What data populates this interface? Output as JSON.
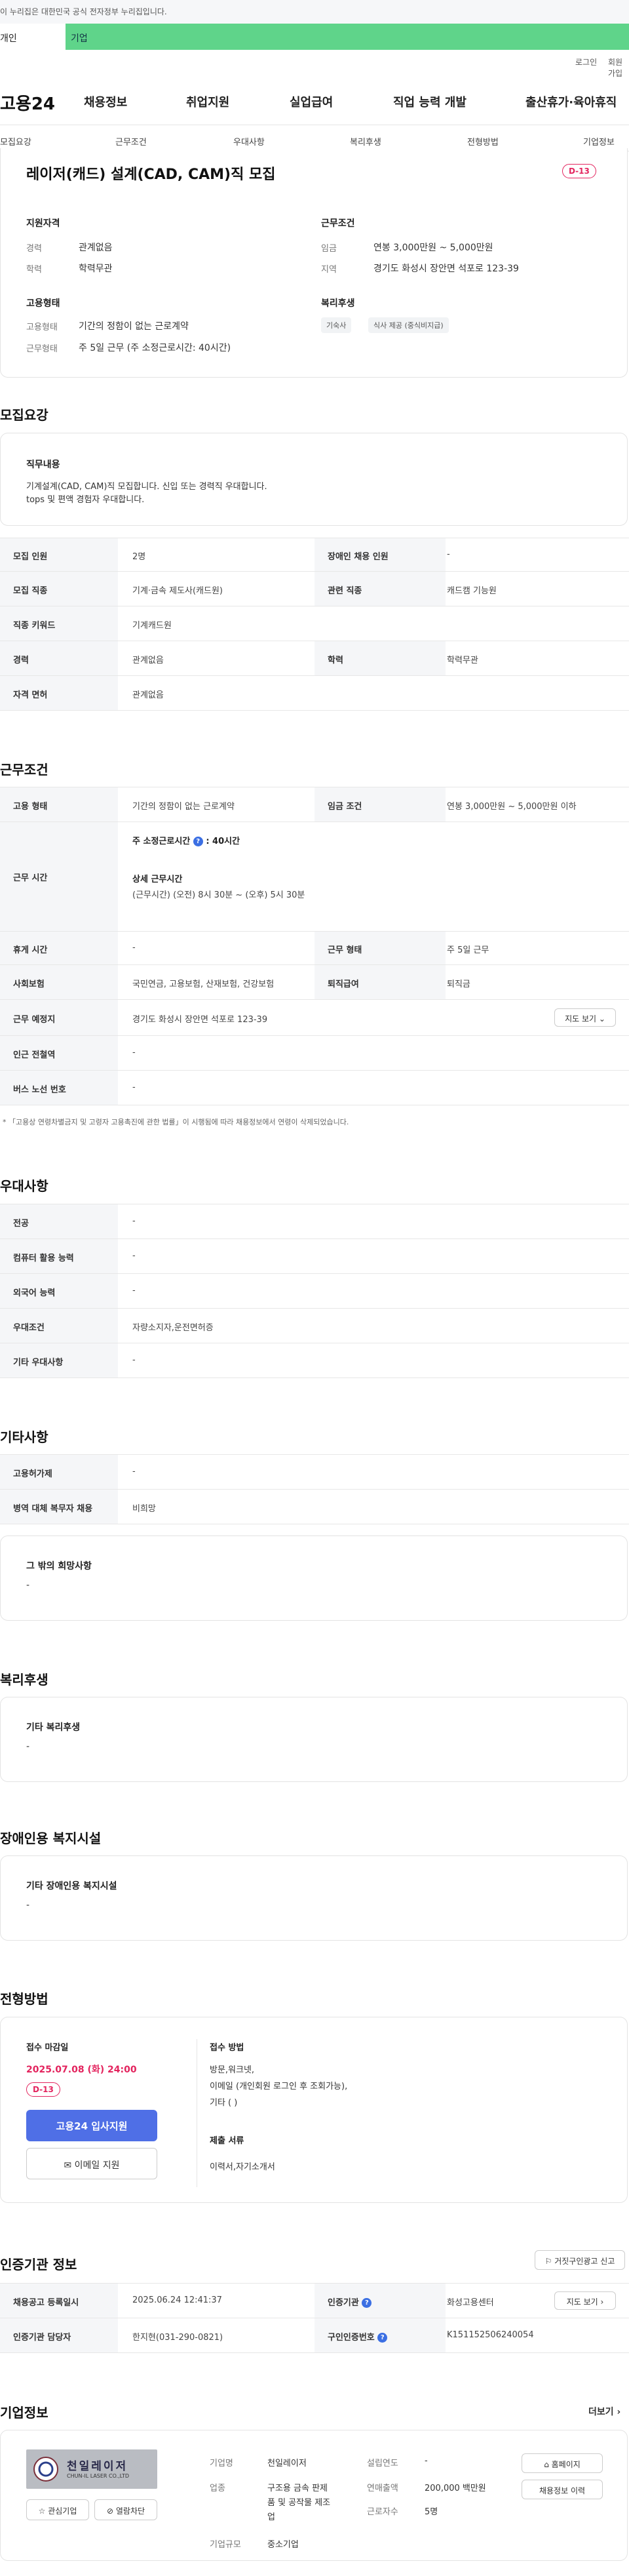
{
  "gov_banner": "이 누리집은 대한민국 공식 전자정부 누리집입니다.",
  "tabs": [
    "개인",
    "기업"
  ],
  "util": [
    "로그인",
    "회원가입"
  ],
  "logo": "고용24",
  "gnb": [
    "채용정보",
    "취업지원",
    "실업급여",
    "직업 능력 개발",
    "출산휴가·육아휴직"
  ],
  "anchors": [
    "모집요강",
    "근무조건",
    "우대사항",
    "복리후생",
    "전형방법",
    "기업정보"
  ],
  "job": {
    "title": "레이저(캐드) 설계(CAD, CAM)직 모집",
    "dday": "D-13",
    "qual_title": "지원자격",
    "career_label": "경력",
    "career": "관계없음",
    "edu_label": "학력",
    "edu": "학력무관",
    "emp_title": "고용형태",
    "emp_label": "고용형태",
    "emp": "기간의 정함이 없는 근로계약",
    "work_label": "근무형태",
    "work": "주 5일 근무 (주 소정근로시간: 40시간)",
    "cond_title": "근무조건",
    "wage_label": "임금",
    "wage": "연봉 3,000만원 ~ 5,000만원",
    "area_label": "지역",
    "area": "경기도 화성시 장안면 석포로 123-39",
    "welfare_title": "복리후생",
    "chips": [
      "기숙사",
      "식사 제공 (중식비지급)"
    ]
  },
  "recruit": {
    "title": "모집요강",
    "duty_title": "직무내용",
    "duty_lines": [
      "기계설계(CAD, CAM)직 모집합니다. 신입 또는 경력직 우대합니다.",
      "tops 및 편액 경험자 우대합니다."
    ],
    "rows": [
      {
        "l1": "모집 인원",
        "v1": "2명",
        "l2": "장애인 채용 인원",
        "v2": "-"
      },
      {
        "l1": "모집 직종",
        "v1": "기계·금속 제도사(캐드원)",
        "l2": "관련 직종",
        "v2": "캐드캠 기능원"
      },
      {
        "l1": "직종 키워드",
        "v1": "기계캐드원"
      },
      {
        "l1": "경력",
        "v1": "관계없음",
        "l2": "학력",
        "v2": "학력무관"
      },
      {
        "l1": "자격 면허",
        "v1": "관계없음"
      }
    ]
  },
  "work_cond": {
    "title": "근무조건",
    "emp_label": "고용 형태",
    "emp": "기간의 정함이 없는 근로계약",
    "wage_label": "임금 조건",
    "wage": "연봉 3,000만원 ~ 5,000만원 이하",
    "time_label": "근무 시간",
    "weekly_label": "주 소정근로시간",
    "weekly": ": 40시간",
    "detail_label": "상세 근무시간",
    "detail": "(근무시간) (오전) 8시 30분 ~ (오후) 5시 30분",
    "rows": [
      {
        "l1": "휴게 시간",
        "v1": "-",
        "l2": "근무 형태",
        "v2": "주 5일 근무"
      },
      {
        "l1": "사회보험",
        "v1": "국민연금, 고용보험, 산재보험, 건강보험",
        "l2": "퇴직급여",
        "v2": "퇴직금"
      }
    ],
    "place_label": "근무 예정지",
    "place": "경기도 화성시 장안면 석포로 123-39",
    "map_btn": "지도 보기",
    "subway_label": "인근 전철역",
    "subway": "-",
    "bus_label": "버스 노선 번호",
    "bus": "-",
    "note": "* 「고용상 연령차별금지 및 고령자 고용촉진에 관한 법률」이 시행됨에 따라 채용정보에서 연령이 삭제되었습니다."
  },
  "pref": {
    "title": "우대사항",
    "rows": [
      {
        "l": "전공",
        "v": "-"
      },
      {
        "l": "컴퓨터 활용 능력",
        "v": "-"
      },
      {
        "l": "외국어 능력",
        "v": "-"
      },
      {
        "l": "우대조건",
        "v": "자량소지자,운전면허증"
      },
      {
        "l": "기타 우대사항",
        "v": "-"
      }
    ]
  },
  "etc": {
    "title": "기타사항",
    "rows": [
      {
        "l": "고용허가제",
        "v": "-"
      },
      {
        "l": "병역 대체 복무자 채용",
        "v": "비희망"
      }
    ],
    "box_title": "그 밖의 희망사항",
    "box_val": "-"
  },
  "welfare": {
    "title": "복리후생",
    "box_title": "기타 복리후생",
    "box_val": "-"
  },
  "disab": {
    "title": "장애인용 복지시설",
    "box_title": "기타 장애인용 복지시설",
    "box_val": "-"
  },
  "process": {
    "title": "전형방법",
    "deadline_label": "접수 마감일",
    "deadline": "2025.07.08 (화) 24:00",
    "dday": "D-13",
    "apply_btn": "고용24 입사지원",
    "email_btn": "이메일 지원",
    "method_label": "접수 방법",
    "method_lines": [
      "방문,워크넷,",
      "이메일 (개인회원 로그인 후 조회가능),",
      "기타 ( )"
    ],
    "docs_label": "제출 서류",
    "docs": "이력서,자기소개서"
  },
  "cert": {
    "title": "인증기관 정보",
    "report_btn": "거짓구인광고 신고",
    "reg_label": "채용공고 등록일시",
    "reg": "2025.06.24 12:41:37",
    "org_label": "인증기관",
    "org": "화성고용센터",
    "map_btn": "지도 보기",
    "mgr_label": "인증기관 담당자",
    "mgr": "한지현(031-290-0821)",
    "num_label": "구인인증번호",
    "num": "K151152506240054"
  },
  "company": {
    "title": "기업정보",
    "more": "더보기",
    "logo_text": "천일레이저",
    "logo_sub": "CHUN-IL LASER CO.,LTD",
    "fav_btn": "관심기업",
    "block_btn": "열람차단",
    "name_label": "기업명",
    "name": "천일레이저",
    "biz_label": "업종",
    "biz_lines": [
      "구조용 금속 판제",
      "품 및 공작물 제조",
      "업"
    ],
    "size_label": "기업규모",
    "size": "중소기업",
    "year_label": "설립연도",
    "year": "-",
    "sales_label": "연매출액",
    "sales": "200,000 백만원",
    "emp_label": "근로자수",
    "emp": "5명",
    "home_btn": "홈페이지",
    "hist_btn": "채용정보 이력"
  }
}
